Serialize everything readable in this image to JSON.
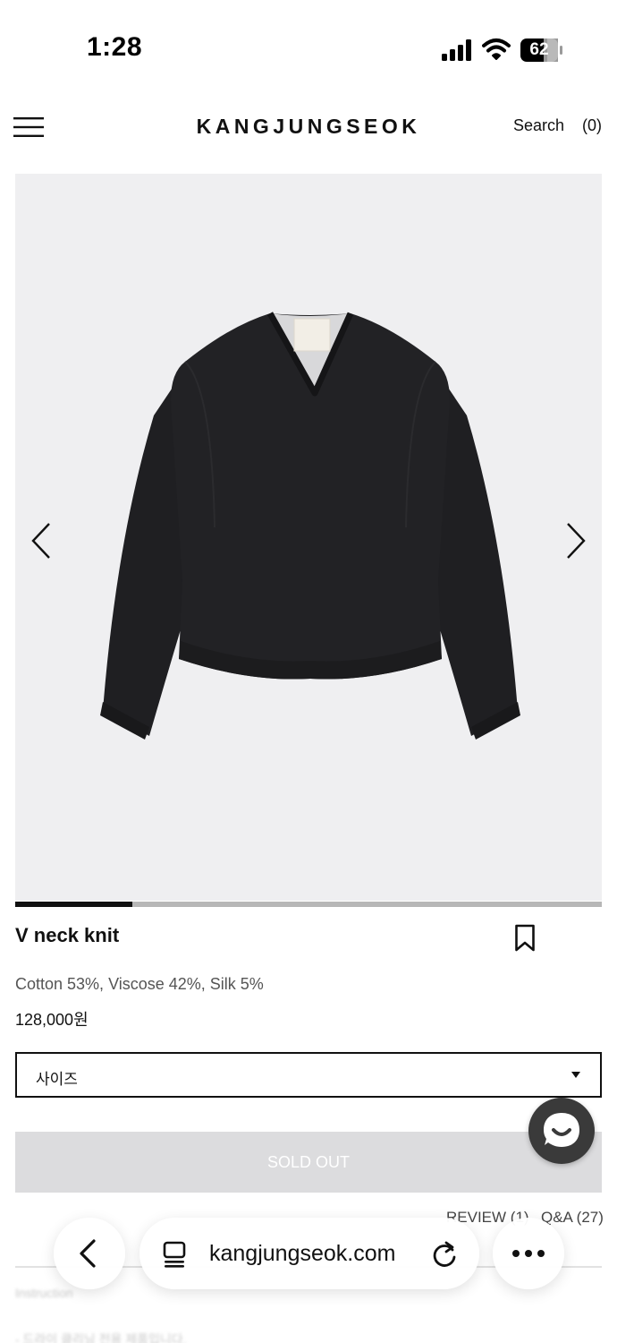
{
  "status_bar": {
    "time": "1:28",
    "battery": "62"
  },
  "header": {
    "logo": "KANGJUNGSEOK",
    "search": "Search",
    "cart": "(0)"
  },
  "gallery": {
    "progress": 0.2
  },
  "product": {
    "name": "V neck knit",
    "material": "Cotton 53%, Viscose 42%, Silk 5%",
    "price": "128,000원"
  },
  "size_select": {
    "label": "사이즈"
  },
  "actions": {
    "sold_out": "SOLD OUT"
  },
  "tabs": {
    "review": "REVIEW (1)",
    "qna": "Q&A (27)"
  },
  "footer_partial": {
    "line1": "Instruction",
    "line2": "- 드라이 클리닝 전용 제품입니다."
  },
  "browser": {
    "url": "kangjungseok.com"
  },
  "colors": {
    "accent": "#111111",
    "image_bg": "#efeff1",
    "soldout_bg": "#dcdcde"
  },
  "icons": [
    "menu-icon",
    "chevron-left-icon",
    "chevron-right-icon",
    "bookmark-icon",
    "caret-down-icon",
    "chat-icon",
    "back-icon",
    "tabs-icon",
    "reload-icon",
    "more-icon"
  ]
}
